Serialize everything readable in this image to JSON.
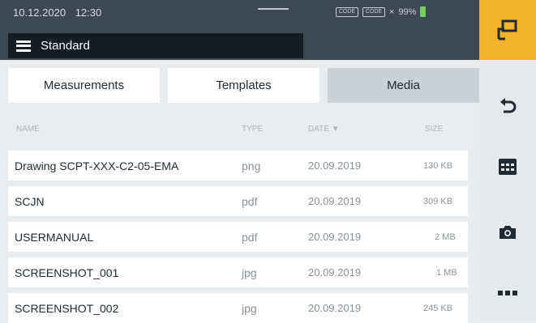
{
  "status": {
    "date": "10.12.2020",
    "time": "12:30",
    "device_chips": [
      "CODE",
      "CODE"
    ],
    "battery": "99%",
    "battery_color": "#6fd05b"
  },
  "menu": {
    "label": "Standard"
  },
  "tabs": [
    {
      "label": "Measurements",
      "active": false
    },
    {
      "label": "Templates",
      "active": false
    },
    {
      "label": "Media",
      "active": true
    }
  ],
  "columns": {
    "name": "NAME",
    "type": "TYPE",
    "date": "DATE ▼",
    "size": "SIZE"
  },
  "rows": [
    {
      "name": "Drawing SCPT-XXX-C2-05-EMA",
      "type": "png",
      "date": "20.09.2019",
      "size": "130 KB"
    },
    {
      "name": "SCJN",
      "type": "pdf",
      "date": "20.09.2019",
      "size": "309 KB"
    },
    {
      "name": "USERMANUAL",
      "type": "pdf",
      "date": "20.09.2019",
      "size": "2 MB"
    },
    {
      "name": "SCREENSHOT_001",
      "type": "jpg",
      "date": "20.09.2019",
      "size": "1 MB"
    },
    {
      "name": "SCREENSHOT_002",
      "type": "jpg",
      "date": "20.09.2019",
      "size": "245 KB"
    }
  ],
  "colors": {
    "accent": "#f3b32a",
    "header_bg": "#3e4852",
    "active_tab": "#c9d0d6"
  },
  "icons": {
    "share": "share-icon",
    "back": "undo-icon",
    "grid": "grid-icon",
    "camera": "camera-icon",
    "more": "more-icon"
  }
}
